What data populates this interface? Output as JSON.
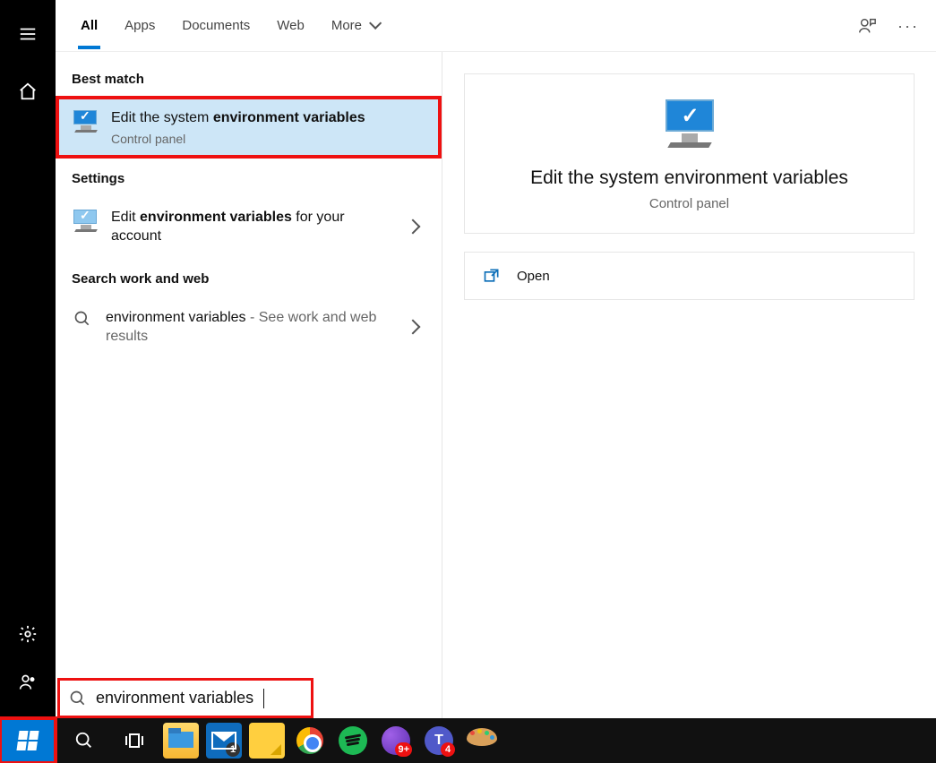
{
  "tabs": {
    "all": "All",
    "apps": "Apps",
    "documents": "Documents",
    "web": "Web",
    "more": "More"
  },
  "sections": {
    "best_match": "Best match",
    "settings": "Settings",
    "search_work_web": "Search work and web"
  },
  "results": {
    "best": {
      "title_pre": "Edit the system ",
      "title_bold": "environment variables",
      "sub": "Control panel"
    },
    "settings_item": {
      "title_pre": "Edit ",
      "title_bold": "environment variables",
      "title_post": " for your account"
    },
    "web_item": {
      "title": "environment variables",
      "suffix": " - See work and web results"
    }
  },
  "preview": {
    "title": "Edit the system environment variables",
    "sub": "Control panel",
    "open": "Open"
  },
  "search": {
    "value": "environment variables"
  },
  "taskbar": {
    "mail_badge": "1",
    "purple_badge": "9+",
    "teams_badge": "4",
    "teams_letter": "T"
  }
}
